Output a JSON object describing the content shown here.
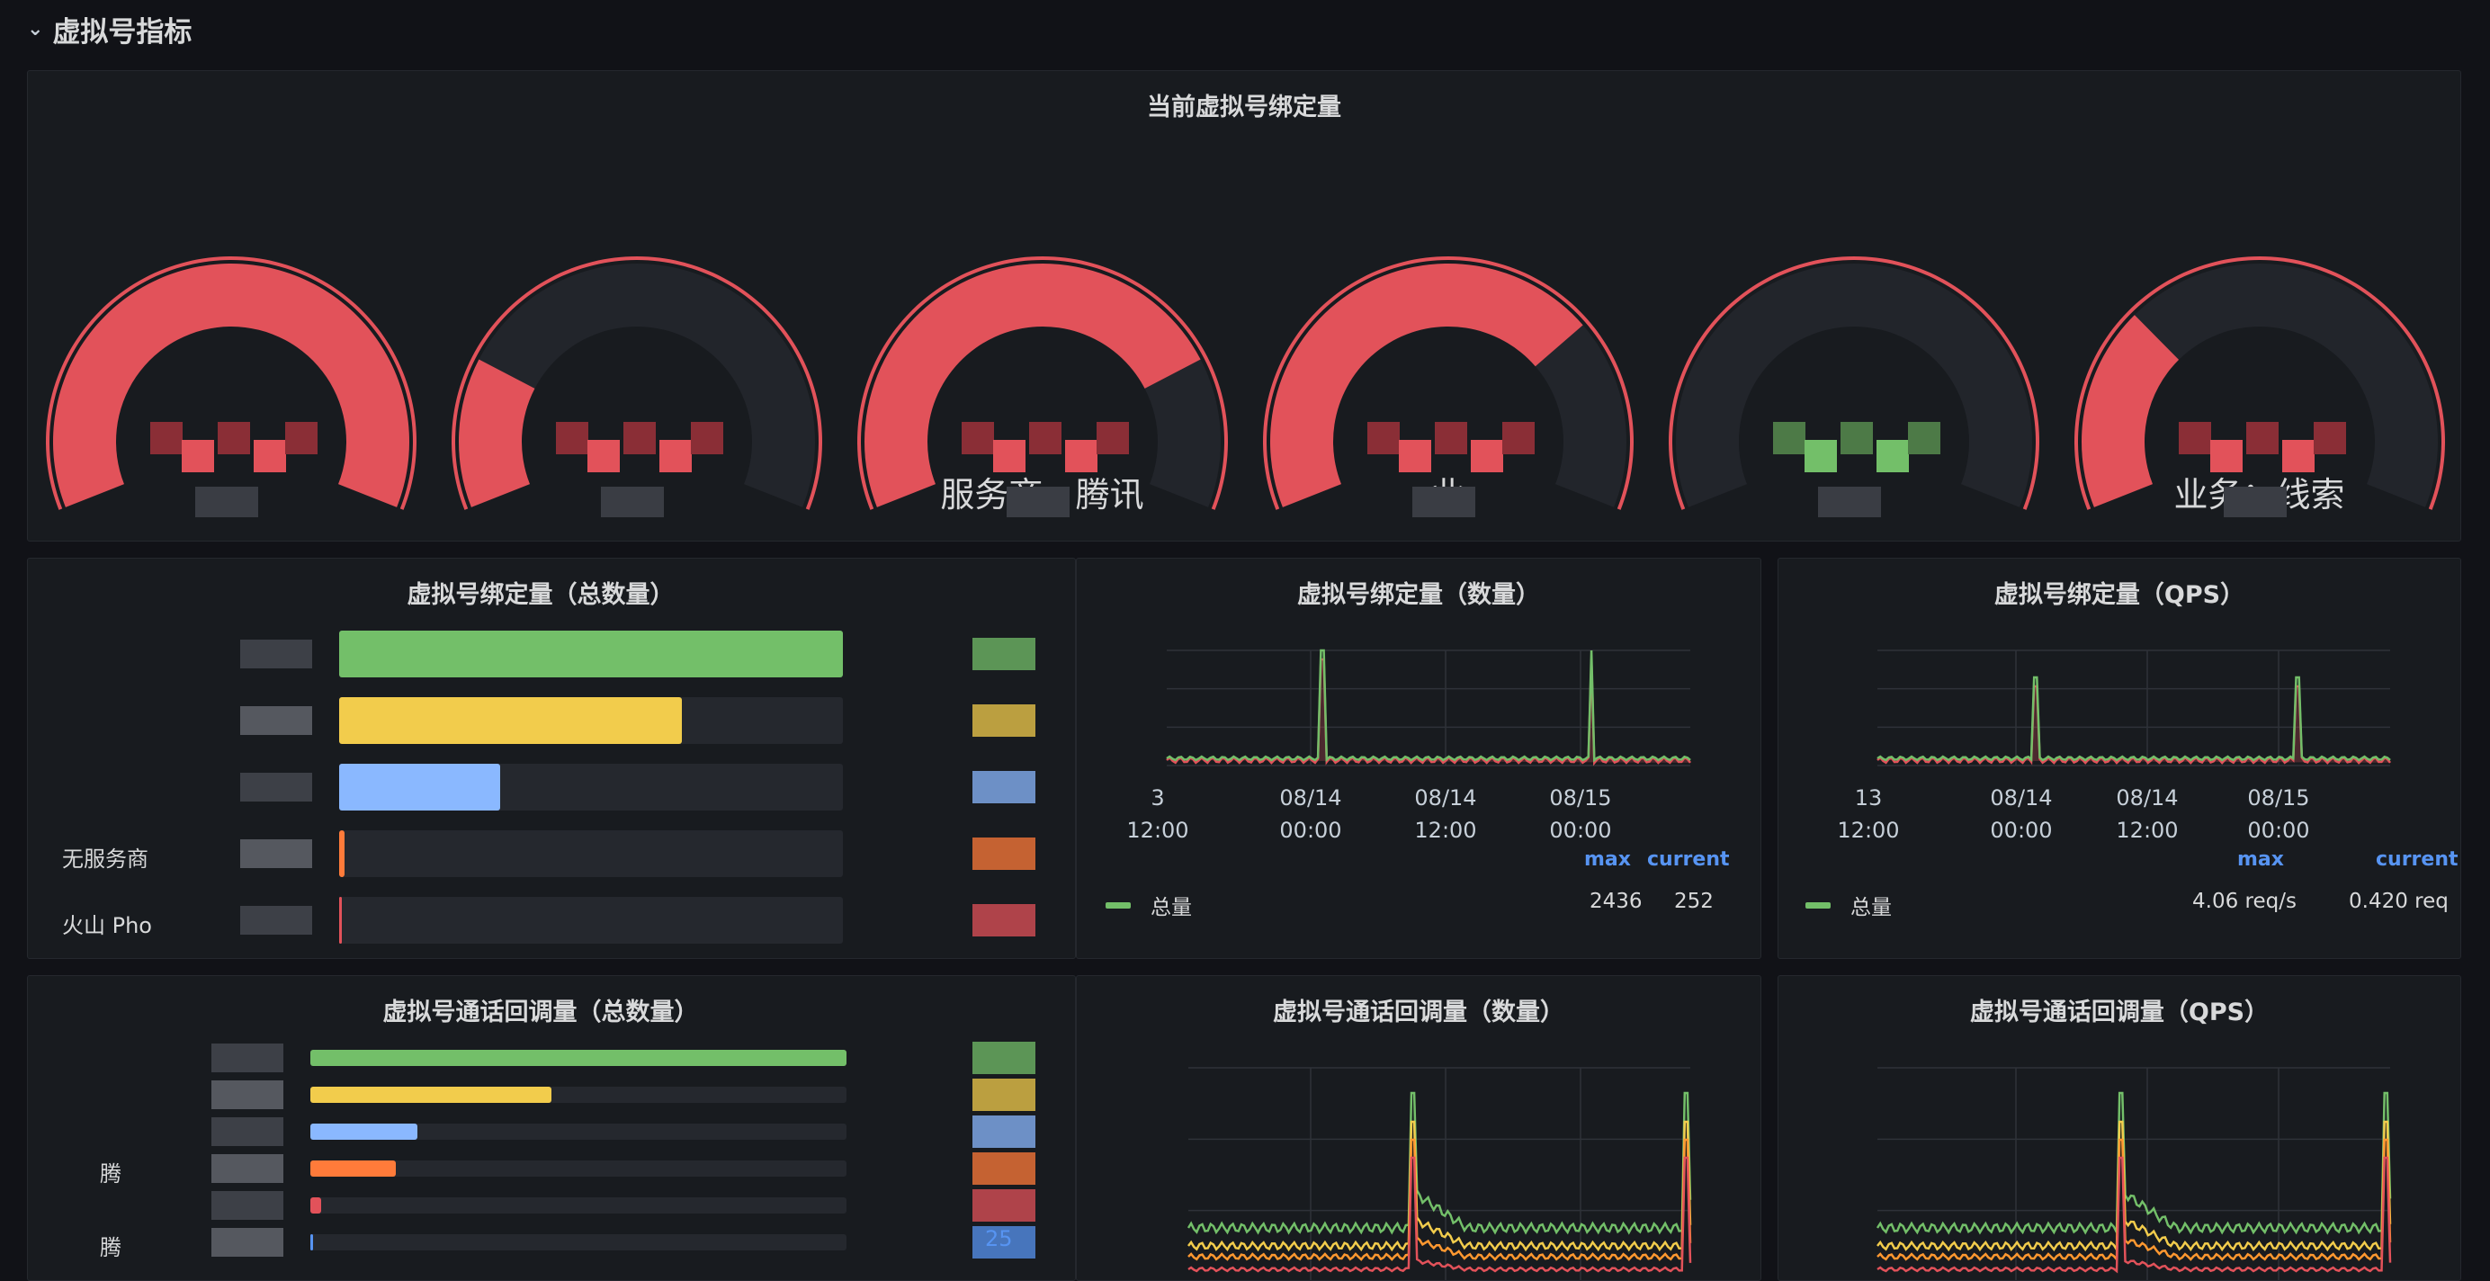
{
  "row": {
    "title": "虚拟号指标",
    "chevron": "›"
  },
  "gauges_panel": {
    "title": "当前虚拟号绑定量",
    "gauges": [
      {
        "fill": 1.0,
        "color": "#e2525a",
        "label": ""
      },
      {
        "fill": 0.22,
        "color": "#e2525a",
        "label": ""
      },
      {
        "fill": 0.78,
        "color": "#e2525a",
        "label": "服务商 · 腾讯"
      },
      {
        "fill": 0.72,
        "color": "#e2525a",
        "label": "业"
      },
      {
        "fill": 0.0,
        "color": "#e2525a",
        "label": ""
      },
      {
        "fill": 0.3,
        "color": "#e2525a",
        "label": "业务：线索"
      }
    ]
  },
  "bind_total": {
    "title": "虚拟号绑定量（总数量）",
    "rows": [
      {
        "label": "",
        "value": 1.0,
        "color": "#73bf69"
      },
      {
        "label": "",
        "value": 0.68,
        "color": "#f2cc4c"
      },
      {
        "label": "",
        "value": 0.32,
        "color": "#8ab8ff"
      },
      {
        "label": "无服务商",
        "value": 0.01,
        "color": "#ff7b3a"
      },
      {
        "label": "火山 Pho",
        "value": 0.005,
        "color": "#e2525a"
      }
    ]
  },
  "bind_count": {
    "title": "虚拟号绑定量（数量）",
    "x_ticks": [
      {
        "l1": "3",
        "l2": "12:00"
      },
      {
        "l1": "08/14",
        "l2": "00:00"
      },
      {
        "l1": "08/14",
        "l2": "12:00"
      },
      {
        "l1": "08/15",
        "l2": "00:00"
      }
    ],
    "legend_max": "max",
    "legend_current": "current",
    "series_name": "总量",
    "series_max": "2436",
    "series_current": "252"
  },
  "bind_qps": {
    "title": "虚拟号绑定量（QPS）",
    "x_ticks": [
      {
        "l1": "13",
        "l2": "12:00"
      },
      {
        "l1": "08/14",
        "l2": "00:00"
      },
      {
        "l1": "08/14",
        "l2": "12:00"
      },
      {
        "l1": "08/15",
        "l2": "00:00"
      }
    ],
    "legend_max": "max",
    "legend_current": "current",
    "series_name": "总量",
    "series_max": "4.06 req/s",
    "series_current": "0.420 req"
  },
  "callback_total": {
    "title": "虚拟号通话回调量（总数量）",
    "rows": [
      {
        "label": "",
        "value": 1.0,
        "color": "#73bf69"
      },
      {
        "label": "",
        "value": 0.45,
        "color": "#f2cc4c"
      },
      {
        "label": "",
        "value": 0.2,
        "color": "#8ab8ff"
      },
      {
        "label": "腾",
        "value": 0.16,
        "color": "#ff7b3a"
      },
      {
        "label": "",
        "value": 0.02,
        "color": "#e2525a"
      },
      {
        "label": "腾",
        "value": 0.005,
        "color": "#5794f2"
      }
    ],
    "tail_value": "25"
  },
  "callback_count": {
    "title": "虚拟号通话回调量（数量）"
  },
  "callback_qps": {
    "title": "虚拟号通话回调量（QPS）"
  },
  "colors": {
    "green": "#73bf69",
    "yellow": "#f2cc4c",
    "blue": "#8ab8ff",
    "orange": "#ff7b3a",
    "red": "#e2525a",
    "gauge_track": "#22252b"
  }
}
